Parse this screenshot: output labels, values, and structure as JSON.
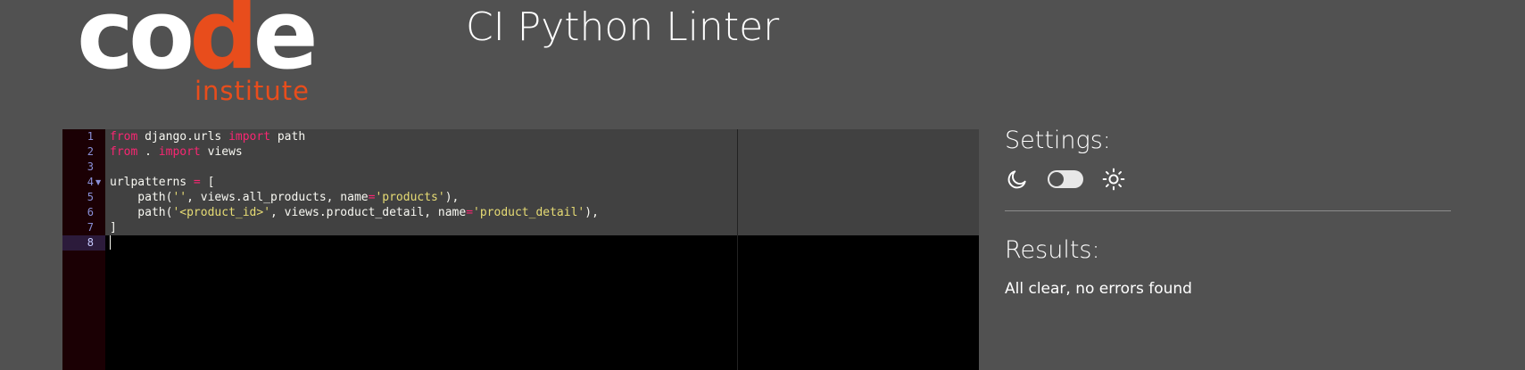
{
  "logo": {
    "word_main": "co",
    "word_accent": "d",
    "word_end": "e",
    "word_sub": "institute",
    "colors": {
      "white": "#ffffff",
      "orange": "#e84d1c"
    }
  },
  "header": {
    "title": "CI Python Linter"
  },
  "editor": {
    "lines": [
      {
        "num": "1",
        "tokens": [
          {
            "t": "from",
            "c": "kw"
          },
          {
            "t": " django.urls ",
            "c": ""
          },
          {
            "t": "import",
            "c": "kw"
          },
          {
            "t": " path",
            "c": ""
          }
        ]
      },
      {
        "num": "2",
        "tokens": [
          {
            "t": "from",
            "c": "kw"
          },
          {
            "t": " . ",
            "c": ""
          },
          {
            "t": "import",
            "c": "kw"
          },
          {
            "t": " views",
            "c": ""
          }
        ]
      },
      {
        "num": "3",
        "tokens": []
      },
      {
        "num": "4",
        "fold": true,
        "tokens": [
          {
            "t": "urlpatterns ",
            "c": ""
          },
          {
            "t": "=",
            "c": "kw"
          },
          {
            "t": " [",
            "c": ""
          }
        ]
      },
      {
        "num": "5",
        "tokens": [
          {
            "t": "    path(",
            "c": ""
          },
          {
            "t": "''",
            "c": "str"
          },
          {
            "t": ", views.all_products, name",
            "c": ""
          },
          {
            "t": "=",
            "c": "kw"
          },
          {
            "t": "'products'",
            "c": "str"
          },
          {
            "t": "),",
            "c": ""
          }
        ]
      },
      {
        "num": "6",
        "tokens": [
          {
            "t": "    path(",
            "c": ""
          },
          {
            "t": "'<product_id>'",
            "c": "str"
          },
          {
            "t": ", views.product_detail, name",
            "c": ""
          },
          {
            "t": "=",
            "c": "kw"
          },
          {
            "t": "'product_detail'",
            "c": "str"
          },
          {
            "t": "),",
            "c": ""
          }
        ]
      },
      {
        "num": "7",
        "tokens": [
          {
            "t": "]",
            "c": ""
          }
        ]
      },
      {
        "num": "8",
        "active": true,
        "tokens": []
      }
    ],
    "colors": {
      "keyword": "#f92672",
      "string": "#e6db74",
      "text": "#f8f8f2",
      "background": "#000000",
      "gutter": "#1b0004"
    }
  },
  "settings": {
    "heading": "Settings:",
    "dark_icon": "moon-icon",
    "light_icon": "sun-icon",
    "theme_toggle_state": "dark"
  },
  "results": {
    "heading": "Results:",
    "message": "All clear, no errors found"
  }
}
